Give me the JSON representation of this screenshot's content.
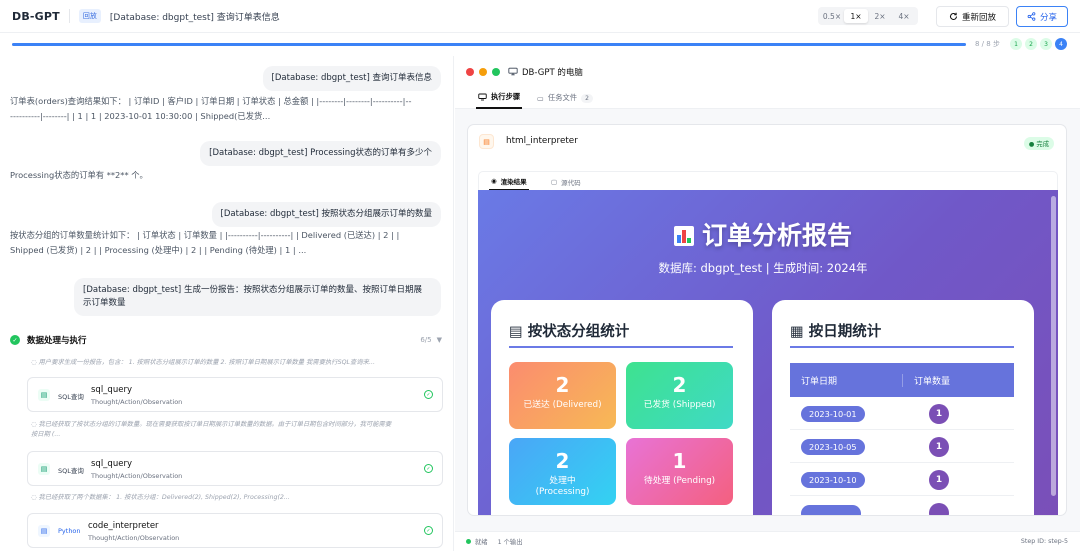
{
  "header": {
    "brand": "DB-GPT",
    "replay_badge": "回放",
    "title": "[Database: dbgpt_test] 查询订单表信息",
    "speeds": [
      "0.5×",
      "1×",
      "2×",
      "4×"
    ],
    "selected_speed": "1×",
    "replay_button": "重新回放",
    "share_button": "分享"
  },
  "progress": {
    "current_step": 8,
    "total_steps": 8,
    "label": "8 / 8 步",
    "steps": [
      "1",
      "2",
      "3",
      "4"
    ],
    "current_step_marker": "4"
  },
  "chat": {
    "messages": [
      {
        "role": "user",
        "text": "[Database: dbgpt_test] 查询订单表信息"
      },
      {
        "role": "assistant",
        "line1": "订单表(orders)查询结果如下： | 订单ID | 客户ID | 订单日期 | 订单状态 | 总金额 | |--------|--------|----------|--",
        "line2": "----------|--------| | 1 | 1 | 2023-10-01 10:30:00 | Shipped(已发货..."
      },
      {
        "role": "user",
        "text": "[Database: dbgpt_test] Processing状态的订单有多少个"
      },
      {
        "role": "assistant",
        "line1": "Processing状态的订单有 **2** 个。"
      },
      {
        "role": "user",
        "text": "[Database: dbgpt_test] 按照状态分组展示订单的数量"
      },
      {
        "role": "assistant",
        "line1": "按状态分组的订单数量统计如下： | 订单状态 | 订单数量 | |----------|----------| | Delivered (已送达) | 2 | |",
        "line2": "Shipped (已发货) | 2 | | Processing (处理中) | 2 | | Pending (待处理) | 1 | ..."
      },
      {
        "role": "user",
        "line1": "[Database: dbgpt_test] 生成一份报告：按照状态分组展示订单的数量、按照订单日期展",
        "line2": "示订单数量"
      }
    ],
    "section": {
      "title": "数据处理与执行",
      "count": "6/5"
    },
    "thoughts": [
      {
        "line1": "用户要求生成一份报告，包含： 1. 按照状态分组展示订单的数量 2. 按照订单日期展示订单数量 我需要执行SQL查询来..."
      },
      {
        "line1": "我已经获取了按状态分组的订单数量。现在需要获取按订单日期展示订单数量的数据。由于订单日期包含时间部分，我可能需要",
        "line2": "按日期 (..."
      },
      {
        "line1": "我已经获取了两个数据集： 1. 按状态分组：Delivered(2), Shipped(2), Processing(2..."
      }
    ],
    "tools": [
      {
        "tag": "SQL查询",
        "name": "sql_query",
        "sub": "Thought/Action/Observation"
      },
      {
        "tag": "SQL查询",
        "name": "sql_query",
        "sub": "Thought/Action/Observation"
      },
      {
        "tag": "Python",
        "name": "code_interpreter",
        "sub": "Thought/Action/Observation"
      }
    ]
  },
  "computer": {
    "title": "DB-GPT 的电脑",
    "tabs": [
      {
        "label": "执行步骤"
      },
      {
        "label": "任务文件",
        "count": "2"
      }
    ],
    "card": {
      "title": "html_interpreter",
      "status": "完成",
      "tabs": [
        "渲染结果",
        "源代码"
      ]
    },
    "report": {
      "title": "订单分析报告",
      "subtitle": "数据库: dbgpt_test | 生成时间: 2024年",
      "status_panel": {
        "title": "按状态分组统计",
        "stats": [
          {
            "value": "2",
            "label": "已送达 (Delivered)",
            "color": "#ff8a70"
          },
          {
            "value": "2",
            "label": "已发货 (Shipped)",
            "color": "#43e597"
          },
          {
            "value": "2",
            "label": "处理中\n(Processing)",
            "color": "#4fb1f6"
          },
          {
            "value": "1",
            "label": "待处理 (Pending)",
            "color": "#ef6ba6"
          }
        ]
      },
      "date_panel": {
        "title": "按日期统计",
        "columns": [
          "订单日期",
          "订单数量"
        ],
        "rows": [
          {
            "date": "2023-10-01",
            "count": "1"
          },
          {
            "date": "2023-10-05",
            "count": "1"
          },
          {
            "date": "2023-10-10",
            "count": "1"
          },
          {
            "date": "",
            "count": ""
          }
        ]
      }
    },
    "status": {
      "ready": "就绪",
      "output": "1 个输出",
      "step_id": "Step ID: step-5"
    }
  }
}
